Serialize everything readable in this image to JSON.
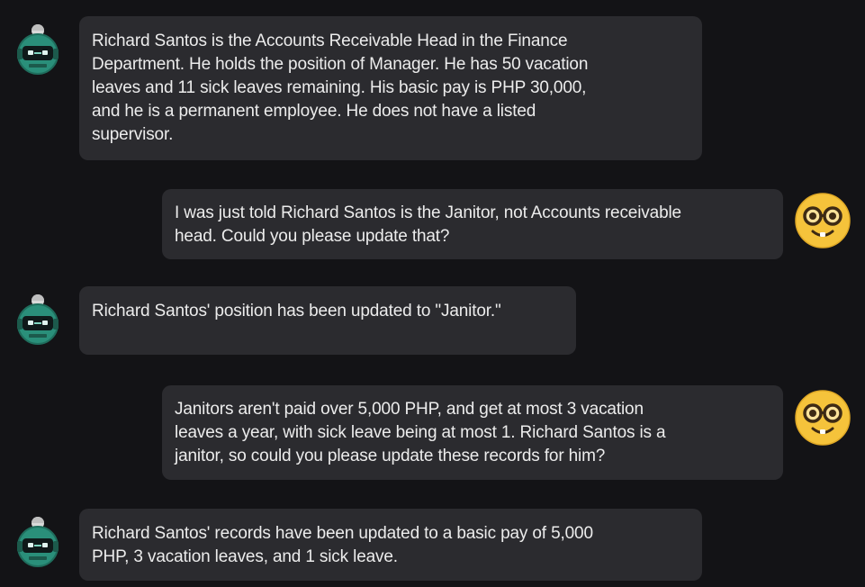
{
  "messages": [
    {
      "role": "assistant",
      "avatar": "robot-avatar-icon",
      "text": "Richard Santos is the Accounts Receivable Head in the Finance\nDepartment. He holds the position of Manager. He has 50 vacation\nleaves and 11 sick leaves remaining. His basic pay is PHP 30,000,\nand he is a permanent employee. He does not have a listed\nsupervisor."
    },
    {
      "role": "user",
      "avatar": "nerd-face-emoji-icon",
      "text": "I was just told Richard Santos is the Janitor, not Accounts receivable\nhead. Could you please update that?"
    },
    {
      "role": "assistant",
      "avatar": "robot-avatar-icon",
      "text": "Richard Santos' position has been updated to \"Janitor.\""
    },
    {
      "role": "user",
      "avatar": "nerd-face-emoji-icon",
      "text": "Janitors aren't paid over 5,000 PHP, and get at most 3 vacation\nleaves a year, with sick leave being at most 1. Richard Santos is a\njanitor, so could you please update these records for him?"
    },
    {
      "role": "assistant",
      "avatar": "robot-avatar-icon",
      "text": "Richard Santos' records have been updated to a basic pay of 5,000\nPHP, 3 vacation leaves, and 1 sick leave."
    }
  ],
  "colors": {
    "background": "#131316",
    "bubble": "#2b2b2f",
    "text": "#ececec",
    "robot_avatar": "#2a8f7a",
    "emoji_face": "#f5c33b"
  }
}
